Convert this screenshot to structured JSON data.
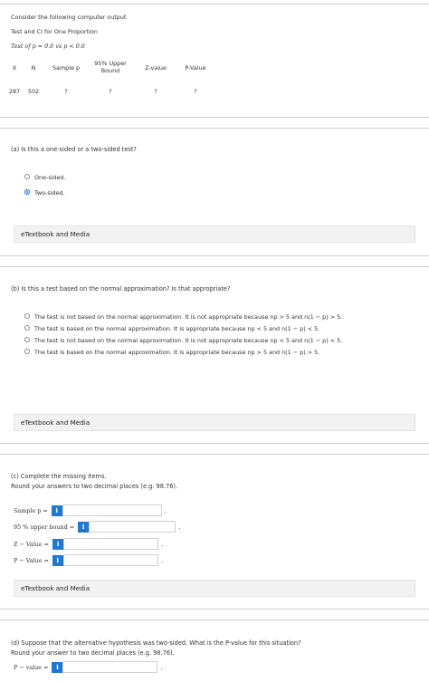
{
  "intro": {
    "line1": "Consider the following computer output",
    "line2": "Test and CI for One Proportion",
    "line3": "Test of p = 0.6 vs p < 0.6"
  },
  "table": {
    "headers": [
      "X",
      "N",
      "Sample p",
      "95% Upper Bound",
      "Z-value",
      "P-Value"
    ],
    "row": [
      "287",
      "502",
      "?",
      "?",
      "?",
      "?"
    ]
  },
  "part_a": {
    "question": "(a) Is this a one-sided or a two-sided test?",
    "options": [
      "One-sided.",
      "Two-sided."
    ],
    "selected": 1,
    "etext": "eTextbook and Media"
  },
  "part_b": {
    "question": "(b) Is this a test based on the normal approximation? Is that appropriate?",
    "options": [
      "The test is not based on the normal approximation. It is not appropriate because np > 5 and n(1 − p) > 5.",
      "The test is based on the normal approximation. It is appropriate because np < 5 and n(1 − p) < 5.",
      "The test is not based on the normal approximation. It is not appropriate because np < 5 and n(1 − p) < 5.",
      "The test is based on the normal approximation. It is appropriate because np > 5 and n(1 − p) > 5."
    ],
    "etext": "eTextbook and Media"
  },
  "part_c": {
    "question": "(c) Complete the missing items.",
    "instruction": "Round your answers to two decimal places (e.g. 98.76).",
    "fields": [
      {
        "label": "Sample p =",
        "value": ""
      },
      {
        "label": "95 % upper bound =",
        "value": ""
      },
      {
        "label": "Z − Value =",
        "value": ""
      },
      {
        "label": "P − Value =",
        "value": ""
      }
    ],
    "info_glyph": "i",
    "etext": "eTextbook and Media"
  },
  "part_d": {
    "question": "(d) Suppose that the alternative hypothesis was two-sided. What is the P-value for this situation?",
    "instruction": "Round your answer to two decimal places (e.g. 98.76).",
    "field_label": "P − value =",
    "field_value": ""
  },
  "colors": {
    "accent": "#1f78d1",
    "panel": "#f2f2f2",
    "rule": "#cfcfcf"
  }
}
